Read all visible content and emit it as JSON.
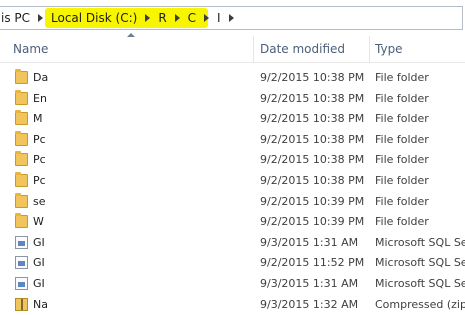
{
  "address_bar": {
    "crumbs": [
      "is PC",
      "Local Disk (C:)",
      "R",
      "C",
      "I"
    ]
  },
  "columns": {
    "name": "Name",
    "date_modified": "Date modified",
    "type": "Type"
  },
  "files": [
    {
      "name": "Da",
      "date": "9/2/2015 10:38 PM",
      "type": "File folder",
      "icon": "folder-icon"
    },
    {
      "name": "En",
      "date": "9/2/2015 10:38 PM",
      "type": "File folder",
      "icon": "folder-icon"
    },
    {
      "name": "M",
      "date": "9/2/2015 10:38 PM",
      "type": "File folder",
      "icon": "folder-icon"
    },
    {
      "name": "Pc",
      "date": "9/2/2015 10:38 PM",
      "type": "File folder",
      "icon": "folder-icon"
    },
    {
      "name": "Pc",
      "date": "9/2/2015 10:38 PM",
      "type": "File folder",
      "icon": "folder-icon"
    },
    {
      "name": "Pc",
      "date": "9/2/2015 10:38 PM",
      "type": "File folder",
      "icon": "folder-icon"
    },
    {
      "name": "se",
      "date": "9/2/2015 10:39 PM",
      "type": "File folder",
      "icon": "folder-icon"
    },
    {
      "name": "W",
      "date": "9/2/2015 10:39 PM",
      "type": "File folder",
      "icon": "folder-icon"
    },
    {
      "name": "GI",
      "date": "9/3/2015 1:31 AM",
      "type": "Microsoft SQL Ser",
      "icon": "sql-file-icon"
    },
    {
      "name": "GI",
      "date": "9/2/2015 11:52 PM",
      "type": "Microsoft SQL Ser",
      "icon": "sql-file-icon"
    },
    {
      "name": "GI",
      "date": "9/3/2015 1:31 AM",
      "type": "Microsoft SQL Ser",
      "icon": "sql-file-icon"
    },
    {
      "name": "Na",
      "date": "9/3/2015 1:32 AM",
      "type": "Compressed (zipp",
      "icon": "zip-file-icon"
    }
  ]
}
